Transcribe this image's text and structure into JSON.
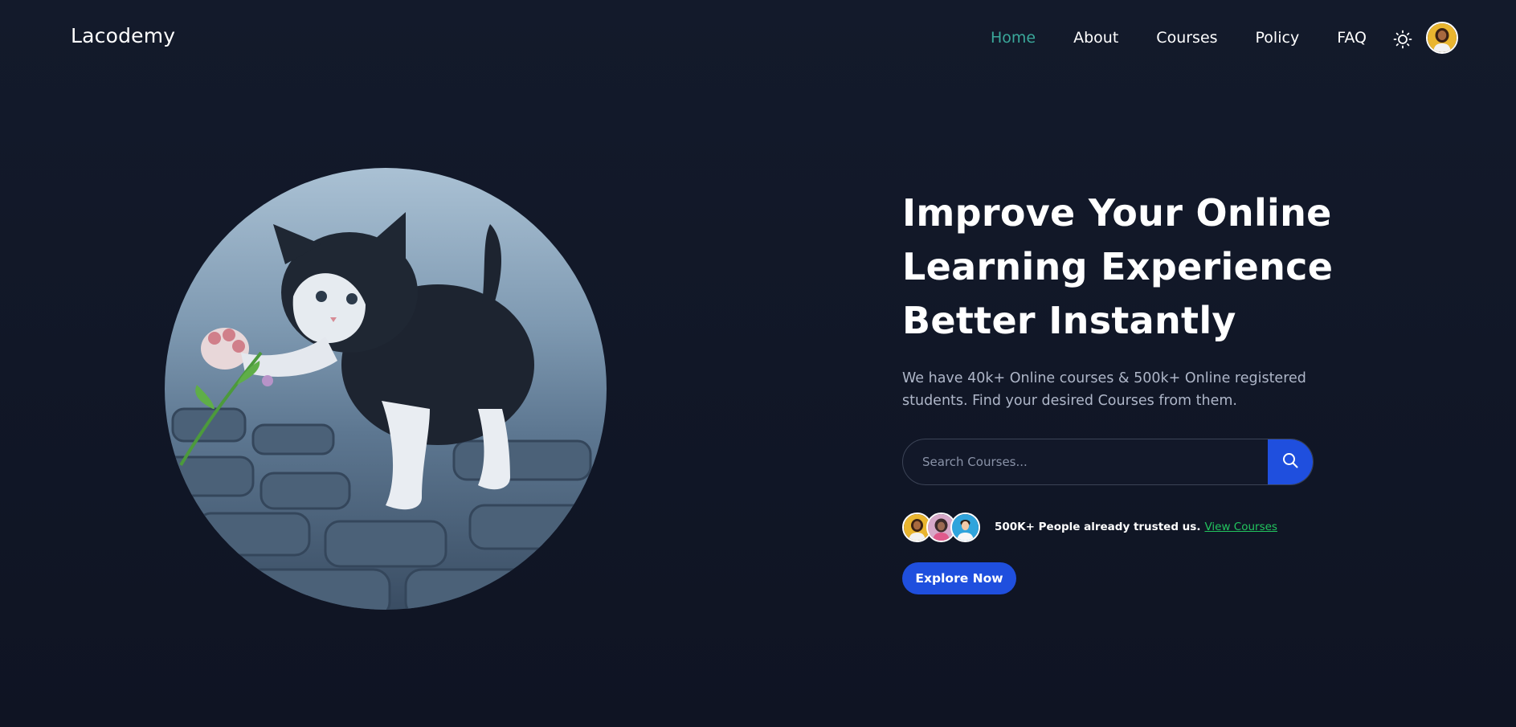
{
  "header": {
    "logo": "Lacodemy",
    "nav": [
      {
        "label": "Home",
        "active": true
      },
      {
        "label": "About",
        "active": false
      },
      {
        "label": "Courses",
        "active": false
      },
      {
        "label": "Policy",
        "active": false
      },
      {
        "label": "FAQ",
        "active": false
      }
    ],
    "theme_icon": "sun-icon",
    "avatar_icon": "user-avatar"
  },
  "hero": {
    "image": "kitten-photo",
    "title_lines": [
      "Improve Your Online",
      "Learning Experience",
      "Better Instantly"
    ],
    "subtitle": "We have 40k+ Online courses & 500k+ Online registered students. Find your desired Courses from them.",
    "search": {
      "placeholder": "Search Courses...",
      "value": "",
      "button_icon": "search-icon"
    },
    "trust": {
      "text": "500K+ People already trusted us.",
      "link": "View Courses"
    },
    "cta": "Explore Now"
  },
  "colors": {
    "background": "#11172a",
    "accent_nav": "#3aa89a",
    "primary_button": "#1f4fde",
    "link": "#22c55e",
    "subtitle": "#aeb6c8"
  }
}
